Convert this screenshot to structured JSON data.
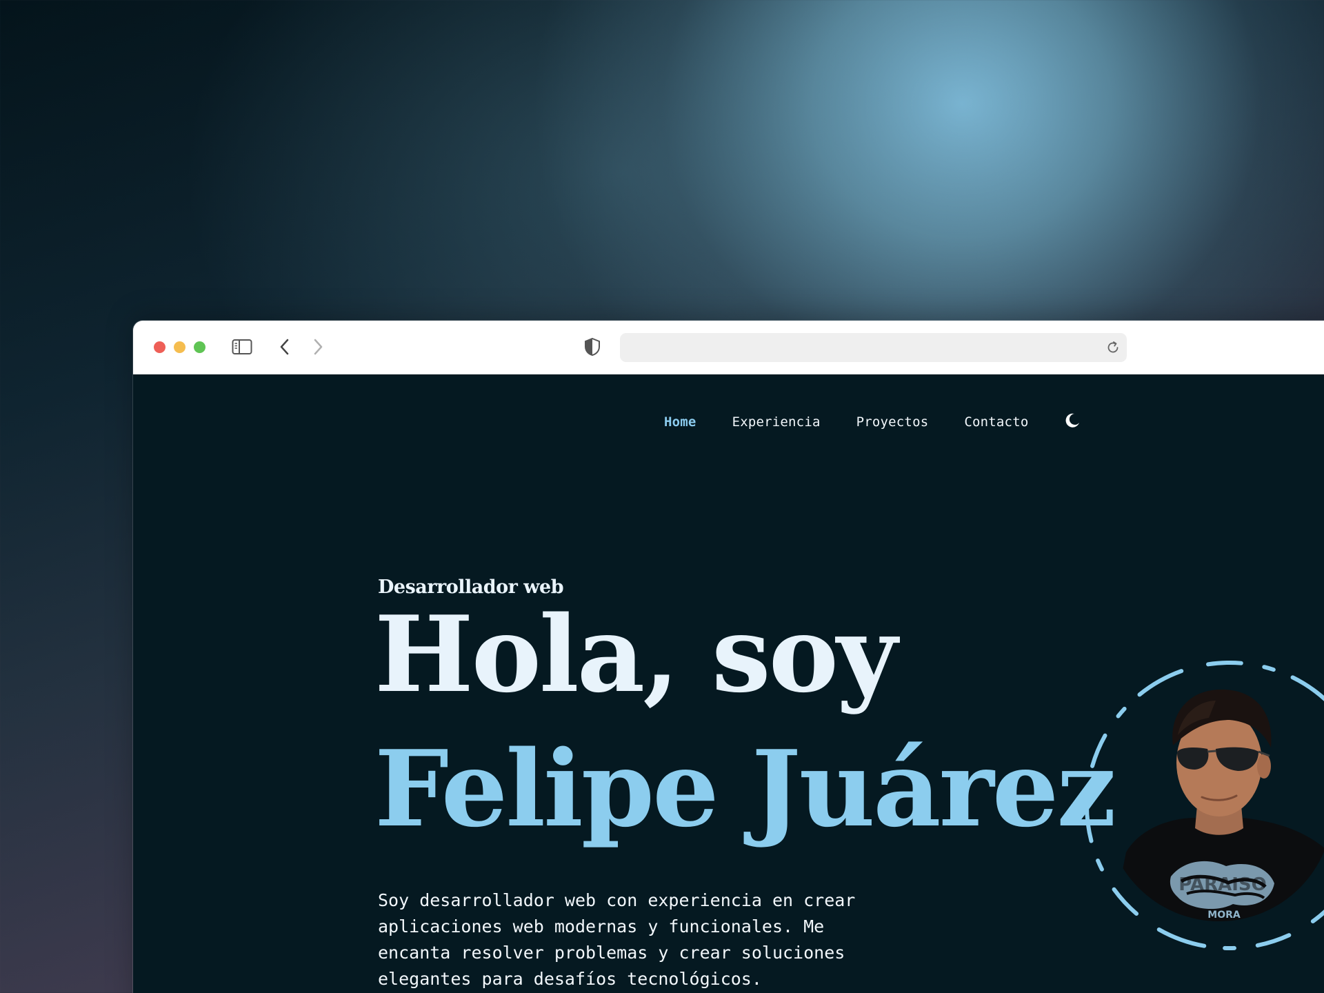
{
  "nav": {
    "items": [
      {
        "label": "Home",
        "active": true
      },
      {
        "label": "Experiencia",
        "active": false
      },
      {
        "label": "Proyectos",
        "active": false
      },
      {
        "label": "Contacto",
        "active": false
      }
    ],
    "theme_toggle_icon": "moon-icon"
  },
  "browser": {
    "address_value": "",
    "icons": [
      "sidebar-icon",
      "chevron-left-icon",
      "chevron-right-icon",
      "shield-icon",
      "reload-icon"
    ]
  },
  "hero": {
    "subtitle": "Desarrollador web",
    "greeting": "Hola, soy",
    "name": "Felipe Juárez",
    "description": "Soy desarrollador web con experiencia en crear aplicaciones web modernas y funcionales. Me encanta resolver problemas y crear soluciones elegantes para desafíos tecnológicos.",
    "shirt_text": "PARAISO",
    "shirt_subtext": "MORA"
  },
  "colors": {
    "page_background": "#051921",
    "accent": "#8ccdee",
    "text": "#e8f3fb"
  }
}
